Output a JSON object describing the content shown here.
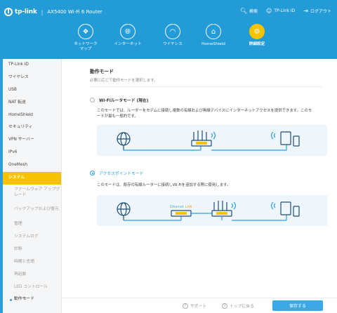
{
  "header": {
    "brand": "tp-link",
    "separator": "|",
    "model": "AX5400 Wi-Fi 6 Router",
    "actions": [
      {
        "icon": "search-icon",
        "label": "検索"
      },
      {
        "icon": "user-icon",
        "label": "TP-Link ID"
      },
      {
        "icon": "logout-icon",
        "label": "ログアウト"
      }
    ]
  },
  "nav": [
    {
      "icon": "network-map-icon",
      "label": "ネットワーク\nマップ",
      "active": false
    },
    {
      "icon": "internet-icon",
      "label": "インターネット",
      "active": false
    },
    {
      "icon": "wireless-icon",
      "label": "ワイヤレス",
      "active": false
    },
    {
      "icon": "homeshield-icon",
      "label": "HomeShield",
      "active": false
    },
    {
      "icon": "gear-icon",
      "label": "詳細設定",
      "active": true
    }
  ],
  "sidebar": {
    "items": [
      "TP-Link ID",
      "ワイヤレス",
      "USB",
      "NAT 転送",
      "HomeShield",
      "セキュリティ",
      "VPN サーバー",
      "IPv6",
      "OneMesh",
      "システム"
    ],
    "active": "システム",
    "subitems": [
      "ファームウェア アップグレード",
      "バックアップおよび復元",
      "管理",
      "システムログ",
      "診断",
      "時間と言語",
      "再起動",
      "LED コントロール",
      "動作モード"
    ],
    "current_sub": "動作モード"
  },
  "main": {
    "title": "動作モード",
    "subtitle": "必要に応じて動作モードを選択します。",
    "modes": [
      {
        "label": "Wi-Fiルータモード (現在)",
        "selected": false,
        "description": "このモードでは、ルーターをモデムに接続し複数の有線および無線デバイスにインターネットアクセスを提供できます。このモードが最も一般的です。"
      },
      {
        "label": "アクセスポイントモード",
        "selected": true,
        "description": "このモードは、既存の有線ルーターに接続しWi-Fiを追加する際に使用します。"
      }
    ],
    "diagram2_labels": {
      "ethernet": "Ethernet",
      "lan": "LAN"
    }
  },
  "footer": {
    "support": "サポート",
    "back_to_top": "トップに戻る",
    "save": "保存する"
  },
  "colors": {
    "accent": "#2b9fd9",
    "active": "#f7c200",
    "header": "#239bd6"
  }
}
